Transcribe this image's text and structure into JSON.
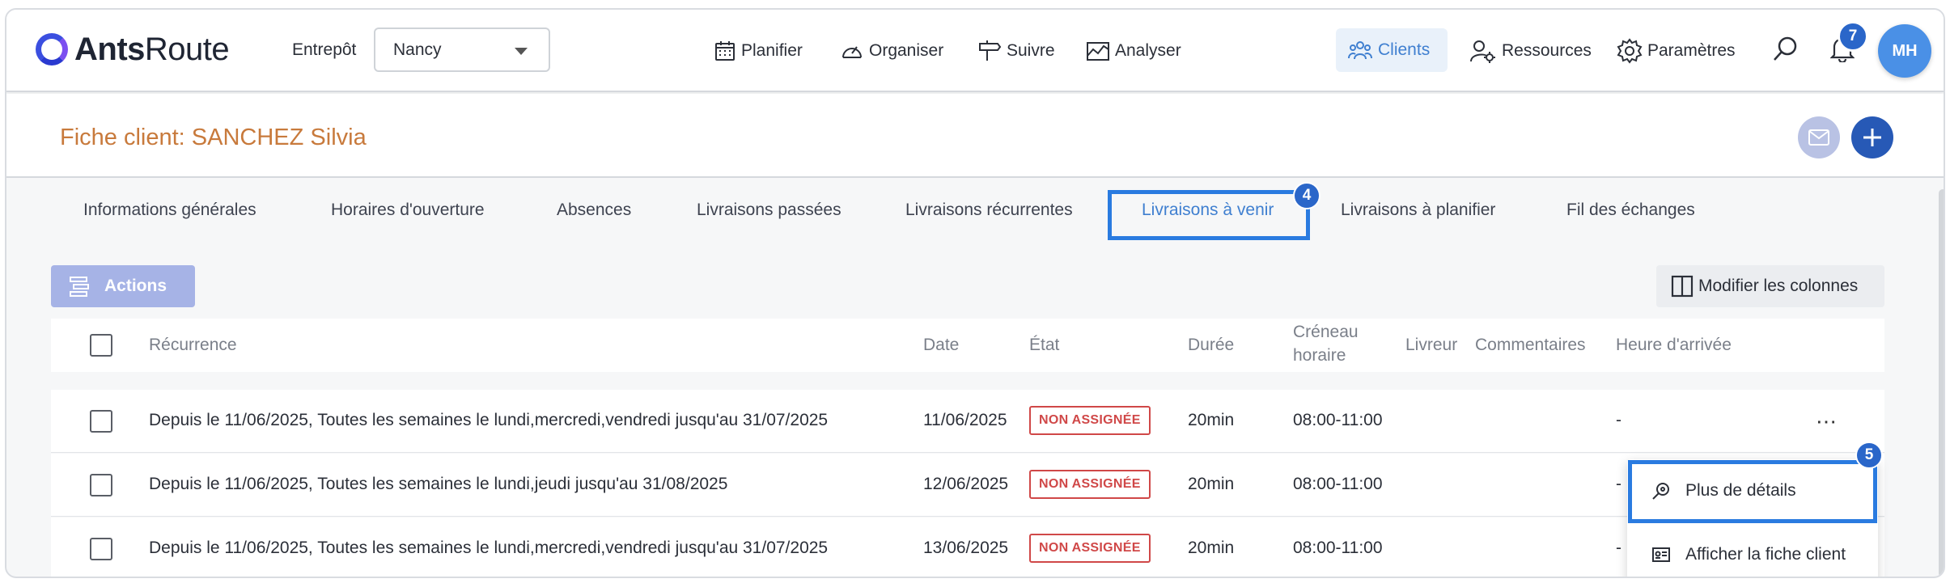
{
  "app": {
    "brand_bold": "Ants",
    "brand_light": "Route"
  },
  "warehouse": {
    "label": "Entrepôt",
    "value": "Nancy"
  },
  "nav": {
    "planifier": "Planifier",
    "organiser": "Organiser",
    "suivre": "Suivre",
    "analyser": "Analyser",
    "clients": "Clients",
    "ressources": "Ressources",
    "parametres": "Paramètres",
    "notifications_count": "7",
    "avatar_initials": "MH"
  },
  "page": {
    "title": "Fiche client: SANCHEZ Silvia"
  },
  "tabs": [
    "Informations générales",
    "Horaires d'ouverture",
    "Absences",
    "Livraisons passées",
    "Livraisons récurrentes",
    "Livraisons à venir",
    "Livraisons à planifier",
    "Fil des échanges"
  ],
  "steps": {
    "tab_step": "4",
    "menu_step": "5"
  },
  "toolbar": {
    "actions_label": "Actions",
    "columns_label": "Modifier les colonnes"
  },
  "table": {
    "headers": {
      "recurrence": "Récurrence",
      "date": "Date",
      "etat": "État",
      "duree": "Durée",
      "creneau_l1": "Créneau",
      "creneau_l2": "horaire",
      "livreur": "Livreur",
      "commentaires": "Commentaires",
      "arrivee": "Heure d'arrivée"
    },
    "rows": [
      {
        "recurrence": "Depuis le 11/06/2025, Toutes les semaines le lundi,mercredi,vendredi jusqu'au 31/07/2025",
        "date": "11/06/2025",
        "etat": "NON ASSIGNÉE",
        "duree": "20min",
        "creneau": "08:00-11:00",
        "arrivee": "-"
      },
      {
        "recurrence": "Depuis le 11/06/2025, Toutes les semaines le lundi,jeudi jusqu'au 31/08/2025",
        "date": "12/06/2025",
        "etat": "NON ASSIGNÉE",
        "duree": "20min",
        "creneau": "08:00-11:00",
        "arrivee": "-"
      },
      {
        "recurrence": "Depuis le 11/06/2025, Toutes les semaines le lundi,mercredi,vendredi jusqu'au 31/07/2025",
        "date": "13/06/2025",
        "etat": "NON ASSIGNÉE",
        "duree": "20min",
        "creneau": "08:00-11:00",
        "arrivee": "-"
      }
    ],
    "more_glyph": "⋯"
  },
  "row_menu": {
    "details": "Plus de détails",
    "client_sheet": "Afficher la fiche client"
  },
  "colors": {
    "accent": "#2a7be0",
    "title": "#c87a3c",
    "status": "#d04848",
    "primary": "#2759b6"
  }
}
